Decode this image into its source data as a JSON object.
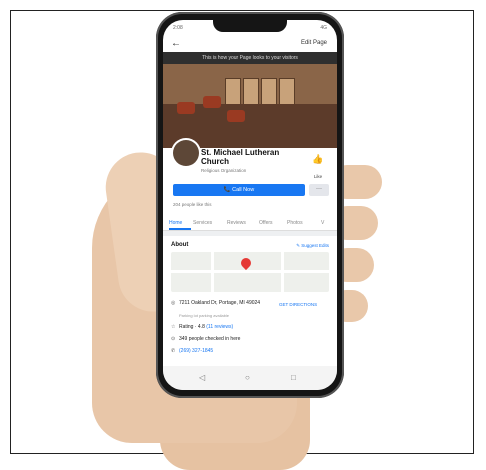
{
  "status": {
    "time": "2:08",
    "signal": "4G"
  },
  "header": {
    "back": "←",
    "edit": "Edit Page"
  },
  "banner": "This is how your Page looks to your visitors",
  "page": {
    "name": "St. Michael Lutheran Church",
    "category": "Religious Organization",
    "like_label": "Like",
    "like_icon": "👍"
  },
  "actions": {
    "call": "📞 Call Now",
    "more": "···"
  },
  "likes": "204 people like this",
  "tabs": [
    "Home",
    "Services",
    "Reviews",
    "Offers",
    "Photos",
    "V"
  ],
  "about": {
    "title": "About",
    "suggest": "✎ Suggest Edits"
  },
  "info": {
    "address": "7211 Oakland Dr, Portage, MI 49024",
    "address_note": "Parking lot parking available",
    "directions": "GET DIRECTIONS",
    "rating": "Rating · 4.8",
    "rating_link": "(11 reviews)",
    "checked": "349 people checked in here",
    "phone": "(269) 327-1845"
  },
  "nav": {
    "back": "◁",
    "home": "○",
    "recent": "□"
  }
}
